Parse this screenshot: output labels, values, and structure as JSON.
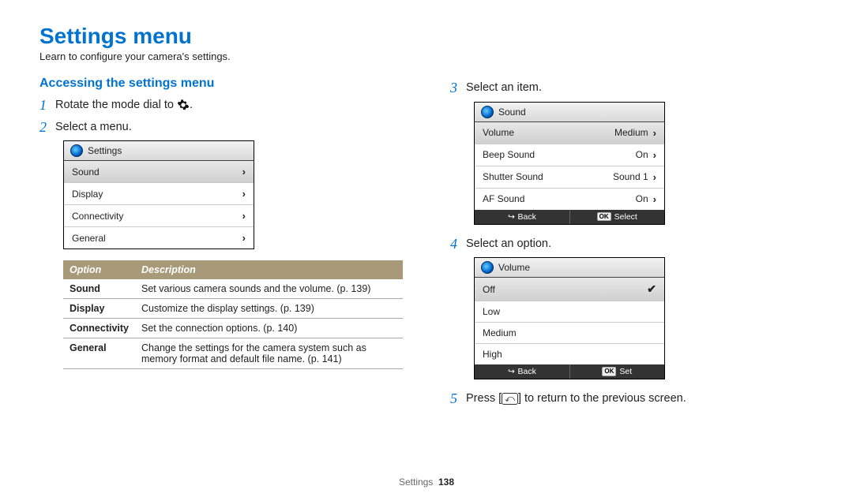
{
  "page": {
    "title": "Settings menu",
    "subtitle": "Learn to configure your camera's settings.",
    "footer_label": "Settings",
    "footer_page": "138"
  },
  "left": {
    "section": "Accessing the settings menu",
    "step1": "Rotate the mode dial to ",
    "step1_end": ".",
    "step2": "Select a menu.",
    "shot1": {
      "header": "Settings",
      "rows": [
        "Sound",
        "Display",
        "Connectivity",
        "General"
      ]
    },
    "table": {
      "h1": "Option",
      "h2": "Description",
      "rows": [
        {
          "opt": "Sound",
          "desc": "Set various camera sounds and the volume. (p. 139)"
        },
        {
          "opt": "Display",
          "desc": "Customize the display settings. (p. 139)"
        },
        {
          "opt": "Connectivity",
          "desc": "Set the connection options. (p. 140)"
        },
        {
          "opt": "General",
          "desc": "Change the settings for the camera system such as memory format and default file name. (p. 141)"
        }
      ]
    }
  },
  "right": {
    "step3": "Select an item.",
    "shot2": {
      "header": "Sound",
      "rows": [
        {
          "label": "Volume",
          "value": "Medium",
          "sel": true
        },
        {
          "label": "Beep Sound",
          "value": "On"
        },
        {
          "label": "Shutter Sound",
          "value": "Sound 1"
        },
        {
          "label": "AF Sound",
          "value": "On"
        }
      ],
      "back": "Back",
      "select": "Select",
      "ok": "OK"
    },
    "step4": "Select an option.",
    "shot3": {
      "header": "Volume",
      "rows": [
        {
          "label": "Off",
          "checked": true
        },
        {
          "label": "Low"
        },
        {
          "label": "Medium"
        },
        {
          "label": "High"
        }
      ],
      "back": "Back",
      "set": "Set",
      "ok": "OK"
    },
    "step5a": "Press [",
    "step5b": "] to return to the previous screen."
  }
}
